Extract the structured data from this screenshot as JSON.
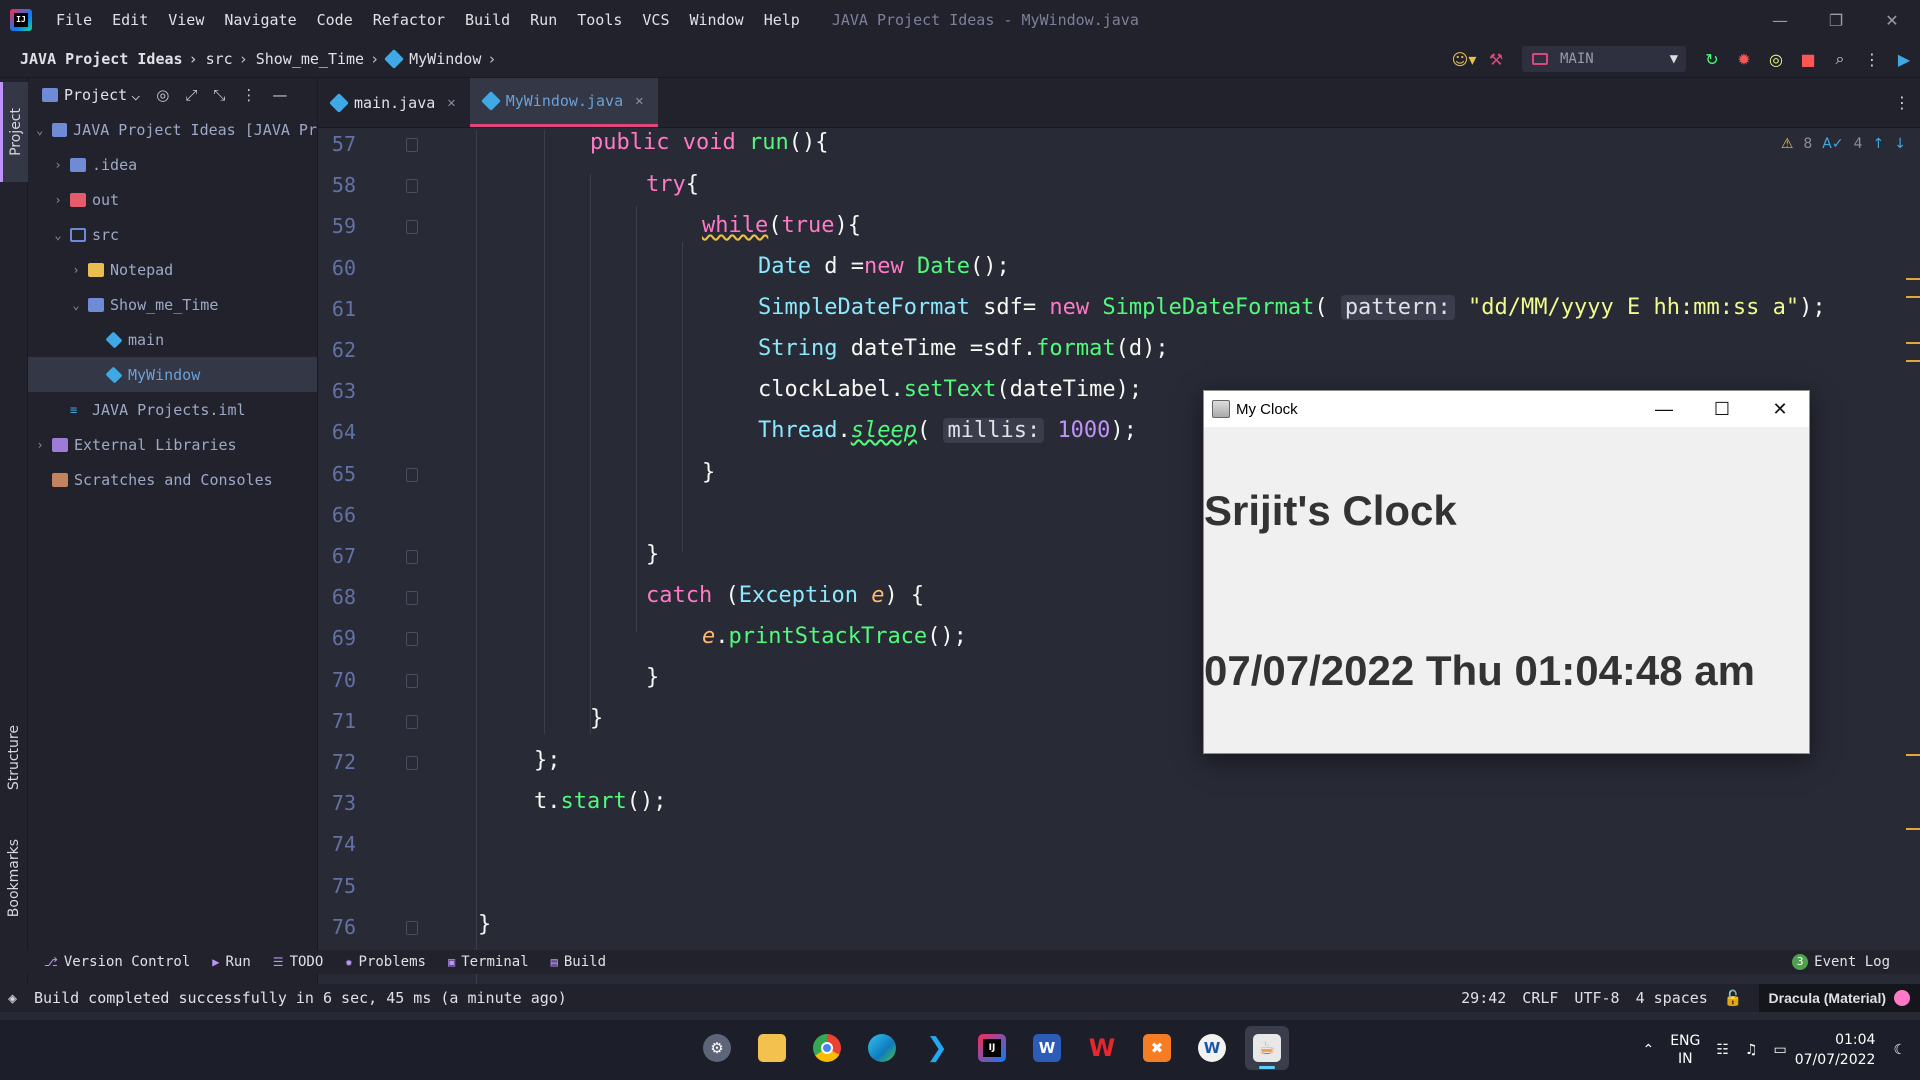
{
  "menubar": {
    "logo_text": "IJ",
    "items": [
      "File",
      "Edit",
      "View",
      "Navigate",
      "Code",
      "Refactor",
      "Build",
      "Run",
      "Tools",
      "VCS",
      "Window",
      "Help"
    ],
    "window_title": "JAVA Project Ideas - MyWindow.java"
  },
  "navbar": {
    "crumbs": [
      "JAVA Project Ideas",
      "src",
      "Show_me_Time",
      "MyWindow"
    ],
    "run_config": "MAIN"
  },
  "left_strip": {
    "project": "Project",
    "structure": "Structure",
    "bookmarks": "Bookmarks"
  },
  "project_panel": {
    "title": "Project",
    "tree": [
      {
        "label": "JAVA Project Ideas [JAVA Pr",
        "indent": 0,
        "arrow": "v",
        "icon": "folder"
      },
      {
        "label": ".idea",
        "indent": 1,
        "arrow": ">",
        "icon": "folder"
      },
      {
        "label": "out",
        "indent": 1,
        "arrow": ">",
        "icon": "folder-red"
      },
      {
        "label": "src",
        "indent": 1,
        "arrow": "v",
        "icon": "src"
      },
      {
        "label": "Notepad",
        "indent": 2,
        "arrow": ">",
        "icon": "folder-yel"
      },
      {
        "label": "Show_me_Time",
        "indent": 2,
        "arrow": "v",
        "icon": "folder"
      },
      {
        "label": "main",
        "indent": 3,
        "arrow": "",
        "icon": "java"
      },
      {
        "label": "MyWindow",
        "indent": 3,
        "arrow": "",
        "icon": "java",
        "selected": true
      },
      {
        "label": "JAVA Projects.iml",
        "indent": 1,
        "arrow": "",
        "icon": "iml"
      },
      {
        "label": "External Libraries",
        "indent": 0,
        "arrow": ">",
        "icon": "lib"
      },
      {
        "label": "Scratches and Consoles",
        "indent": 0,
        "arrow": "",
        "icon": "scratch"
      }
    ]
  },
  "editor": {
    "tabs": [
      {
        "label": "main.java",
        "active": false
      },
      {
        "label": "MyWindow.java",
        "active": true
      }
    ],
    "warnings": "8",
    "typos": "4",
    "line_numbers": [
      "57",
      "58",
      "59",
      "60",
      "61",
      "62",
      "63",
      "64",
      "65",
      "66",
      "67",
      "68",
      "69",
      "70",
      "71",
      "72",
      "73",
      "74",
      "75",
      "76"
    ]
  },
  "toolwindows": {
    "items": [
      "Version Control",
      "Run",
      "TODO",
      "Problems",
      "Terminal",
      "Build"
    ],
    "event_log": "Event Log",
    "event_badge": "3"
  },
  "statusbar": {
    "message": "Build completed successfully in 6 sec, 45 ms (a minute ago)",
    "position": "29:42",
    "line_sep": "CRLF",
    "encoding": "UTF-8",
    "indent": "4 spaces",
    "theme": "Dracula (Material)"
  },
  "taskbar": {
    "lang_top": "ENG",
    "lang_bottom": "IN",
    "time": "01:04",
    "date": "07/07/2022"
  },
  "clock_window": {
    "title": "My Clock",
    "heading": "Srijit's Clock",
    "time_text": "07/07/2022 Thu 01:04:48 am"
  },
  "colors": {
    "accent": "#bd93f9",
    "keyword": "#ff79c6",
    "function": "#50fa7b",
    "type": "#8be9fd",
    "string": "#f1fa8c"
  }
}
